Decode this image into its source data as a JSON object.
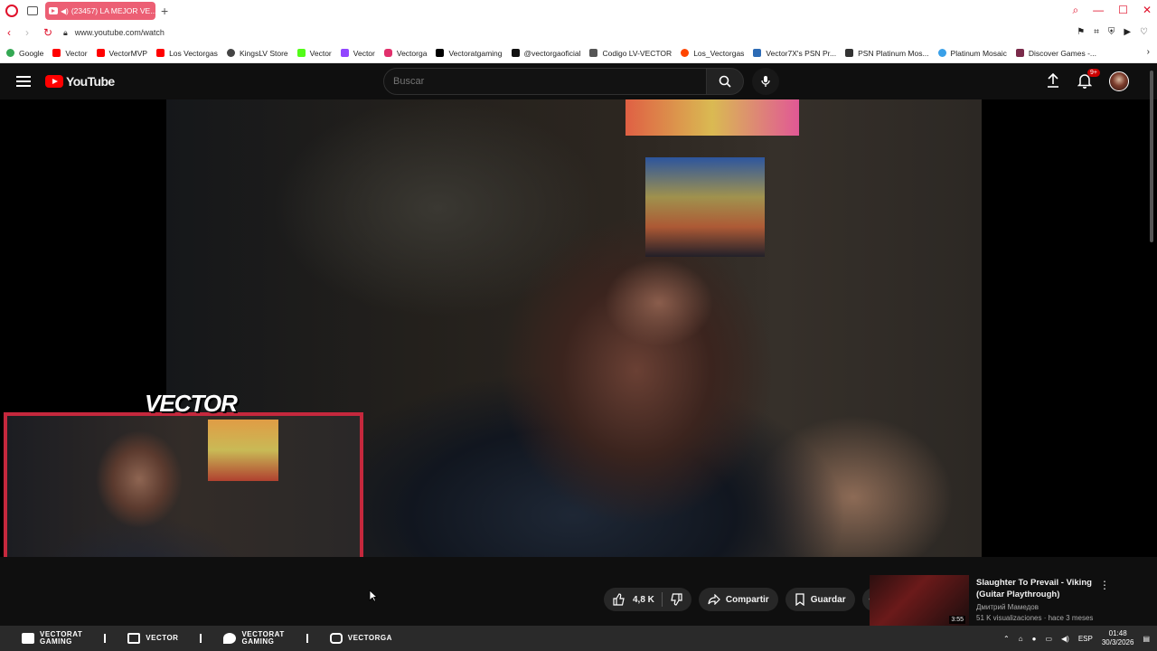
{
  "browser": {
    "tab_title": "(23457) LA MEJOR VE...",
    "url": "www.youtube.com/watch",
    "colors": {
      "accent": "#e0112b",
      "tab": "#ec5f74"
    }
  },
  "bookmarks": [
    "Google",
    "Vector",
    "VectorMVP",
    "Los Vectorgas",
    "KingsLV Store",
    "Vector",
    "Vector",
    "Vectorga",
    "Vectoratgaming",
    "@vectorgaoficial",
    "Codigo LV-VECTOR",
    "Los_Vectorgas",
    "Vector7X's PSN Pr...",
    "PSN Platinum Mos...",
    "Platinum Mosaic",
    "Discover Games -..."
  ],
  "youtube": {
    "logo": "YouTube",
    "search_placeholder": "Buscar",
    "notif_badge": "9+"
  },
  "video": {
    "overlay_label": "VECTOR"
  },
  "actions": {
    "likes": "4,8 K",
    "share": "Compartir",
    "save": "Guardar"
  },
  "recommendation": {
    "title": "Slaughter To Prevail - Viking (Guitar Playthrough)",
    "channel": "Дмитрий Мамедов",
    "meta": "51 K visualizaciones · hace 3 meses",
    "duration": "3:55"
  },
  "taskbar": {
    "items": [
      {
        "label": "VECTORAT\nGAMING"
      },
      {
        "label": "VECTOR"
      },
      {
        "label": "VECTORAT\nGAMING"
      },
      {
        "label": "VECTORGA"
      }
    ],
    "lang": "ESP",
    "time": "01:48",
    "date": "30/3/2026"
  }
}
